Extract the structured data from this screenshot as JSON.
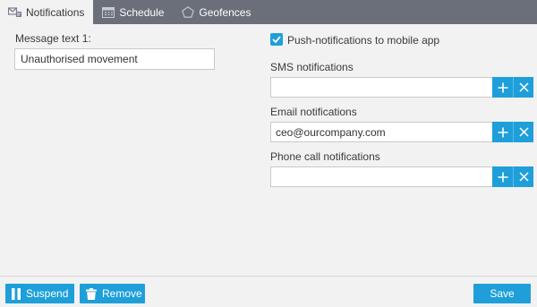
{
  "tabs": [
    {
      "label": "Notifications",
      "icon": "notifications-icon",
      "active": true
    },
    {
      "label": "Schedule",
      "icon": "calendar-icon",
      "active": false
    },
    {
      "label": "Geofences",
      "icon": "pentagon-icon",
      "active": false
    }
  ],
  "message": {
    "label": "Message text 1:",
    "value": "Unauthorised movement"
  },
  "push": {
    "checked": true,
    "label": "Push-notifications to mobile app"
  },
  "sms": {
    "label": "SMS notifications",
    "value": ""
  },
  "email": {
    "label": "Email notifications",
    "value": "ceo@ourcompany.com"
  },
  "phone": {
    "label": "Phone call notifications",
    "value": ""
  },
  "footer": {
    "suspend_label": "Suspend",
    "remove_label": "Remove",
    "save_label": "Save"
  },
  "colors": {
    "accent": "#1e9fd9",
    "tabbar": "#6a6f7a",
    "panel": "#f2f2f2"
  }
}
